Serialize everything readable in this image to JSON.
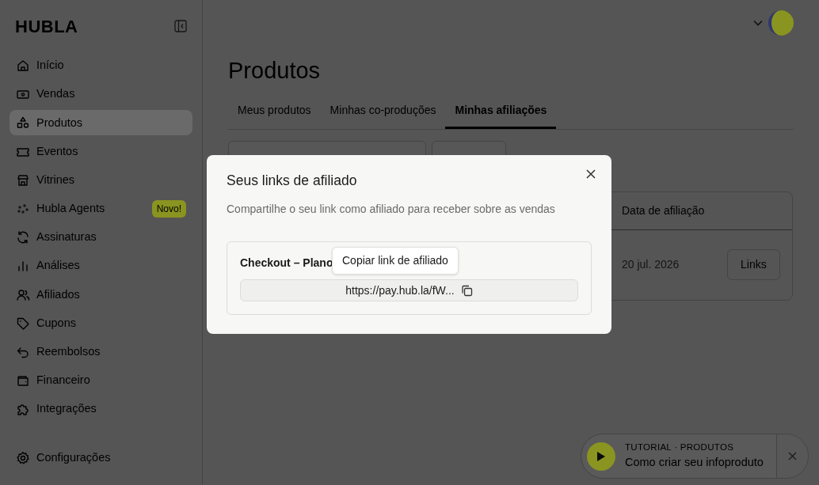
{
  "sidebar": {
    "logo": "HUBLA",
    "items": [
      {
        "label": "Início",
        "selected": false
      },
      {
        "label": "Vendas",
        "selected": false
      },
      {
        "label": "Produtos",
        "selected": true
      },
      {
        "label": "Eventos",
        "selected": false
      },
      {
        "label": "Vitrines",
        "selected": false
      },
      {
        "label": "Hubla Agents",
        "selected": false,
        "badge": "Novo!"
      },
      {
        "label": "Assinaturas",
        "selected": false
      },
      {
        "label": "Análises",
        "selected": false
      },
      {
        "label": "Afiliados",
        "selected": false
      },
      {
        "label": "Cupons",
        "selected": false
      },
      {
        "label": "Reembolsos",
        "selected": false
      },
      {
        "label": "Financeiro",
        "selected": false
      },
      {
        "label": "Integrações",
        "selected": false
      }
    ],
    "footer_item": {
      "label": "Configurações"
    }
  },
  "page": {
    "title": "Produtos",
    "tabs": [
      {
        "label": "Meus produtos",
        "selected": false
      },
      {
        "label": "Minhas co-produções",
        "selected": false
      },
      {
        "label": "Minhas afiliações",
        "selected": true
      }
    ],
    "table": {
      "column_header": "Data de afiliação",
      "date": "20 jul. 2026",
      "action": "Links"
    }
  },
  "modal": {
    "title": "Seus links de afiliado",
    "description": "Compartilhe o seu link como afiliado para receber sobre as vendas",
    "link_label": "Checkout – Plano",
    "link": "https://pay.hub.la/fW...",
    "tooltip": "Copiar link de afiliado"
  },
  "tutorial": {
    "caption": "TUTORIAL · PRODUTOS",
    "title": "Como criar seu infoproduto"
  }
}
